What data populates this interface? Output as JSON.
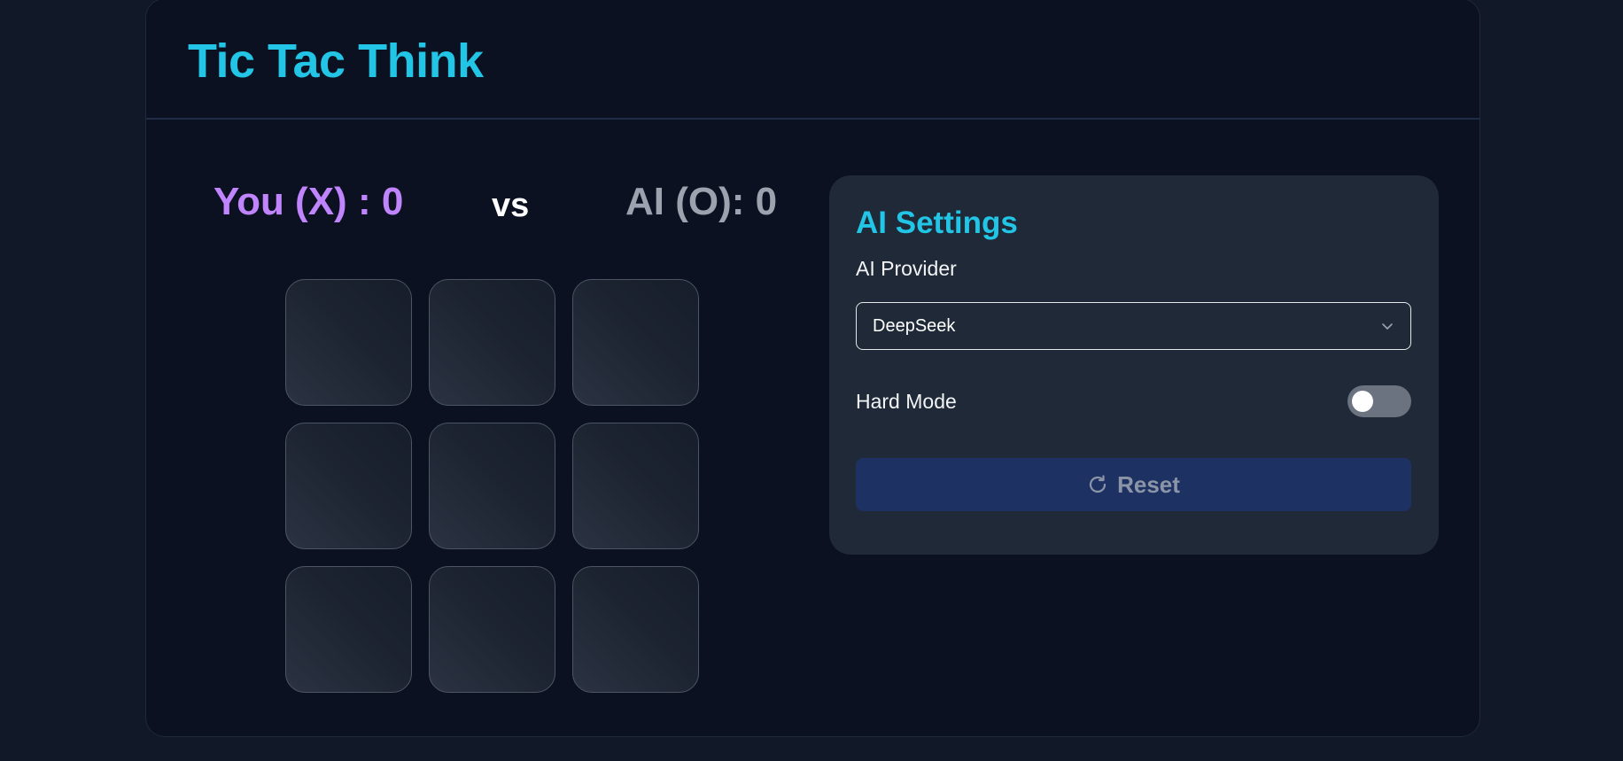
{
  "app": {
    "title": "Tic Tac Think"
  },
  "scoreboard": {
    "you_label": "You (X) : 0",
    "vs_label": "vs",
    "ai_label": "AI (O): 0",
    "colors": {
      "you": "#c084fc",
      "ai": "#9ca3af"
    }
  },
  "board": {
    "cells": [
      "",
      "",
      "",
      "",
      "",
      "",
      "",
      "",
      ""
    ]
  },
  "settings": {
    "title": "AI Settings",
    "provider_label": "AI Provider",
    "provider_value": "DeepSeek",
    "hard_mode_label": "Hard Mode",
    "hard_mode_enabled": false,
    "reset_label": "Reset",
    "reset_icon": "refresh-icon"
  },
  "theme": {
    "accent": "#22c5e6",
    "background": "#111827",
    "card": "#0b1120",
    "panel": "#1f2937",
    "reset_button": "#1e3163"
  }
}
